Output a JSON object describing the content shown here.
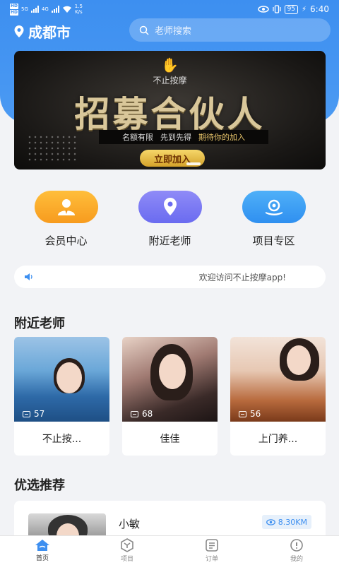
{
  "status_bar": {
    "sim1": "HD",
    "sim2": "HD",
    "net1": "5G",
    "net2": "4G",
    "speed_value": "1.5",
    "speed_unit": "K/s",
    "battery": "95",
    "time": "6:40"
  },
  "header": {
    "city": "成都市",
    "search_placeholder": "老师搜索"
  },
  "banner": {
    "brand": "不止按摩",
    "headline": "招募合伙人",
    "slogan_1": "名额有限",
    "slogan_2": "先到先得",
    "slogan_3": "期待你的加入",
    "join_label": "立即加入"
  },
  "quick_entries": [
    {
      "label": "会员中心",
      "icon": "member-icon"
    },
    {
      "label": "附近老师",
      "icon": "location-icon"
    },
    {
      "label": "项目专区",
      "icon": "project-icon"
    }
  ],
  "notice": {
    "text": "欢迎访问不止按摩app!"
  },
  "nearby": {
    "title": "附近老师",
    "teachers": [
      {
        "name": "不止按...",
        "views": "57"
      },
      {
        "name": "佳佳",
        "views": "68"
      },
      {
        "name": "上门养...",
        "views": "56"
      }
    ]
  },
  "recommend": {
    "title": "优选推荐",
    "items": [
      {
        "name": "小敏",
        "distance": "8.30KM"
      }
    ]
  },
  "tabbar": {
    "tabs": [
      {
        "label": "首页",
        "icon": "home-icon",
        "active": true
      },
      {
        "label": "项目",
        "icon": "project-tab-icon",
        "active": false
      },
      {
        "label": "订单",
        "icon": "order-icon",
        "active": false
      },
      {
        "label": "我的",
        "icon": "profile-icon",
        "active": false
      }
    ]
  },
  "colors": {
    "primary": "#3d8ff0",
    "orange": "#f79b1e",
    "purple": "#6a6bf0",
    "blue": "#2f8ff0",
    "gold": "#e6c36a"
  }
}
